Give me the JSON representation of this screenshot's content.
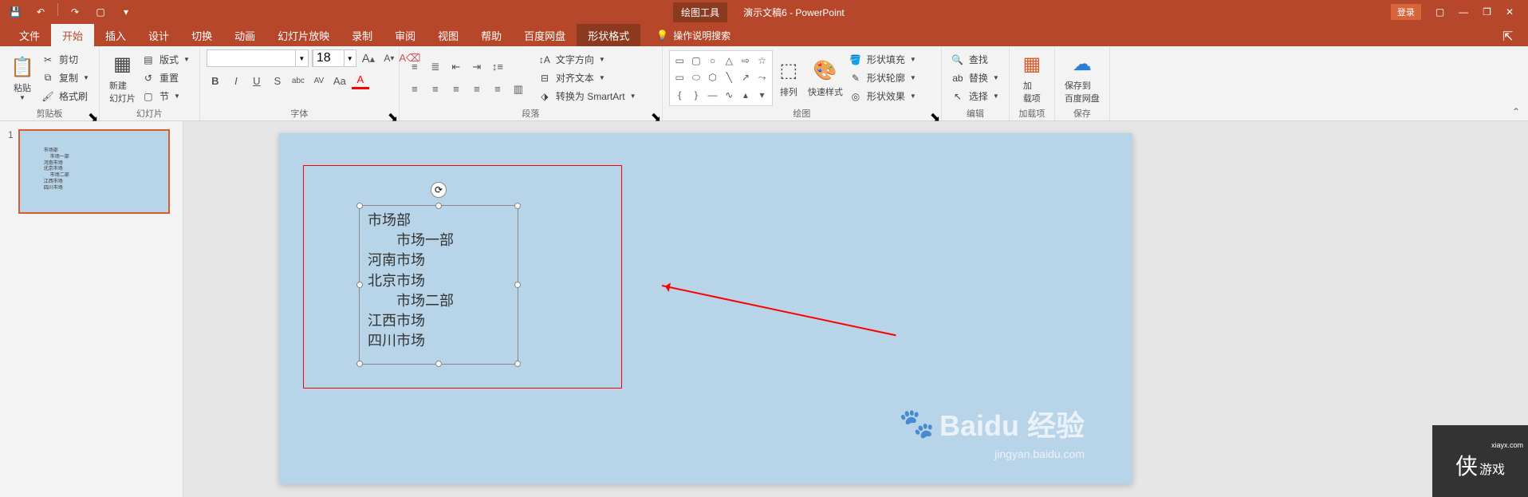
{
  "qat": {
    "save": "💾",
    "undo": "↶",
    "redo": "↷",
    "new": "▢"
  },
  "title": {
    "context": "绘图工具",
    "doc": "演示文稿6 - PowerPoint"
  },
  "window": {
    "login": "登录"
  },
  "tabs": {
    "file": "文件",
    "home": "开始",
    "insert": "插入",
    "design": "设计",
    "transition": "切换",
    "animation": "动画",
    "slideshow": "幻灯片放映",
    "record": "录制",
    "review": "审阅",
    "view": "视图",
    "help": "帮助",
    "baidu": "百度网盘",
    "format": "形状格式"
  },
  "tellme": "操作说明搜索",
  "clipboard": {
    "paste": "粘贴",
    "cut": "剪切",
    "copy": "复制",
    "painter": "格式刷",
    "label": "剪贴板"
  },
  "slides": {
    "new": "新建\n幻灯片",
    "layout": "版式",
    "reset": "重置",
    "section": "节",
    "label": "幻灯片"
  },
  "font": {
    "family": "",
    "size": "18",
    "increase": "A",
    "decrease": "A",
    "clear": "Aₓ",
    "bold": "B",
    "italic": "I",
    "underline": "U",
    "strike": "S",
    "shadow": "abc",
    "spacing": "AV",
    "case": "Aa",
    "color": "A",
    "label": "字体"
  },
  "paragraph": {
    "textdir": "文字方向",
    "align": "对齐文本",
    "smartart": "转换为 SmartArt",
    "label": "段落"
  },
  "drawing": {
    "arrange": "排列",
    "quickstyle": "快速样式",
    "fill": "形状填充",
    "outline": "形状轮廓",
    "effects": "形状效果",
    "label": "绘图"
  },
  "editing": {
    "find": "查找",
    "replace": "替换",
    "select": "选择",
    "label": "编辑"
  },
  "addins": {
    "btn": "加\n载项",
    "label": "加载项"
  },
  "save": {
    "btn": "保存到\n百度网盘",
    "label": "保存"
  },
  "thumb": {
    "num": "1"
  },
  "textbox": {
    "lines": [
      "市场部",
      "市场一部",
      "河南市场",
      "北京市场",
      "市场二部",
      "江西市场",
      "四川市场"
    ]
  },
  "watermark": {
    "main": "Baidu 经验",
    "sub": "jingyan.baidu.com",
    "corner_small": "xiayx.com",
    "corner_big": "侠",
    "corner_sub": "游戏"
  }
}
